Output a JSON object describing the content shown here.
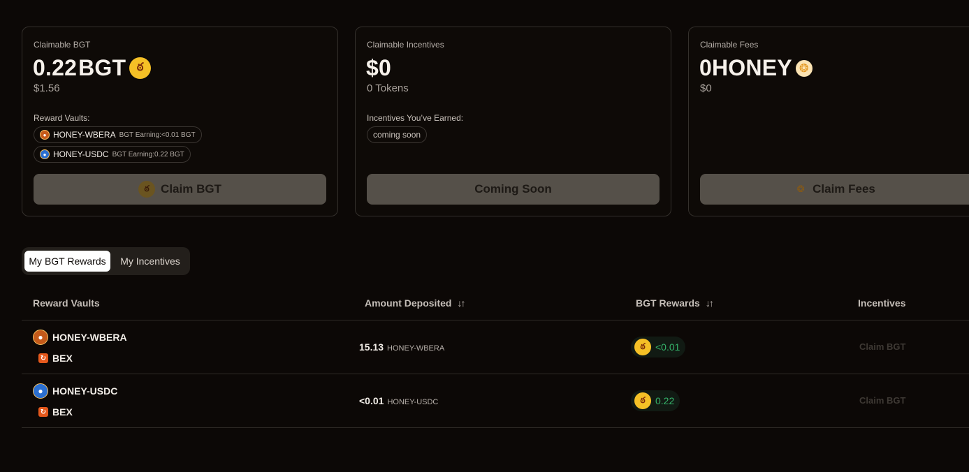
{
  "cards": {
    "bgt": {
      "label": "Claimable BGT",
      "amount": "0.22",
      "unit": "BGT",
      "usd": "$1.56",
      "vaults_label": "Reward Vaults:",
      "vaults": [
        {
          "name": "HONEY-WBERA",
          "earning": "BGT Earning:<0.01 BGT"
        },
        {
          "name": "HONEY-USDC",
          "earning": "BGT Earning:0.22 BGT"
        }
      ],
      "button_label": "Claim BGT"
    },
    "incentives": {
      "label": "Claimable Incentives",
      "amount": "$0",
      "sub": "0 Tokens",
      "earned_label": "Incentives You’ve Earned:",
      "earned_pill": "coming soon",
      "button_label": "Coming Soon"
    },
    "fees": {
      "label": "Claimable Fees",
      "amount": "0",
      "unit": "HONEY",
      "usd": "$0",
      "button_label": "Claim Fees"
    }
  },
  "tabs": [
    "My BGT Rewards",
    "My Incentives"
  ],
  "table": {
    "headers": {
      "vaults": "Reward Vaults",
      "deposited": "Amount Deposited",
      "rewards": "BGT Rewards",
      "incentives": "Incentives"
    },
    "rows": [
      {
        "vault": "HONEY-WBERA",
        "protocol": "BEX",
        "amount": "15.13",
        "token": "HONEY-WBERA",
        "reward": "<0.01",
        "action": "Claim BGT"
      },
      {
        "vault": "HONEY-USDC",
        "protocol": "BEX",
        "amount": "<0.01",
        "token": "HONEY-USDC",
        "reward": "0.22",
        "action": "Claim BGT"
      }
    ]
  },
  "icons": {
    "bgt": "bgt-coin-icon",
    "honey": "honey-icon",
    "sort": "sort-arrows-icon",
    "bex": "bex-icon"
  },
  "colors": {
    "background": "#0c0806",
    "accent_gold": "#f5c026",
    "reward_green": "#35b36a",
    "button_disabled": "#555049"
  }
}
